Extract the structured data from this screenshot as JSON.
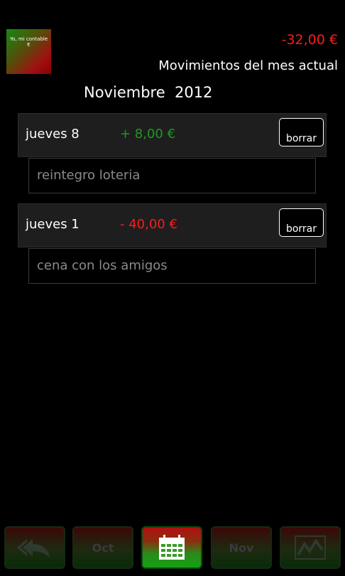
{
  "app": {
    "logo_line1": "Yo, mi contable",
    "logo_line2": "€"
  },
  "header": {
    "balance": "-32,00 €",
    "subtitle": "Movimientos del mes actual",
    "month": "Noviembre  2012"
  },
  "entries": [
    {
      "date": "jueves 8",
      "amount": "+ 8,00 €",
      "delete_label": "borrar",
      "description": "reintegro loteria"
    },
    {
      "date": "jueves 1",
      "amount": "- 40,00 €",
      "delete_label": "borrar",
      "description": "cena con los amigos"
    }
  ],
  "bottom_bar": {
    "back_icon": "back-arrow-icon",
    "prev_month": "Oct",
    "calendar_icon": "calendar-icon",
    "next_month": "Nov",
    "chart_icon": "chart-icon"
  },
  "colors": {
    "negative": "#ff1a1a",
    "positive": "#1f9a1f",
    "background": "#000000"
  }
}
